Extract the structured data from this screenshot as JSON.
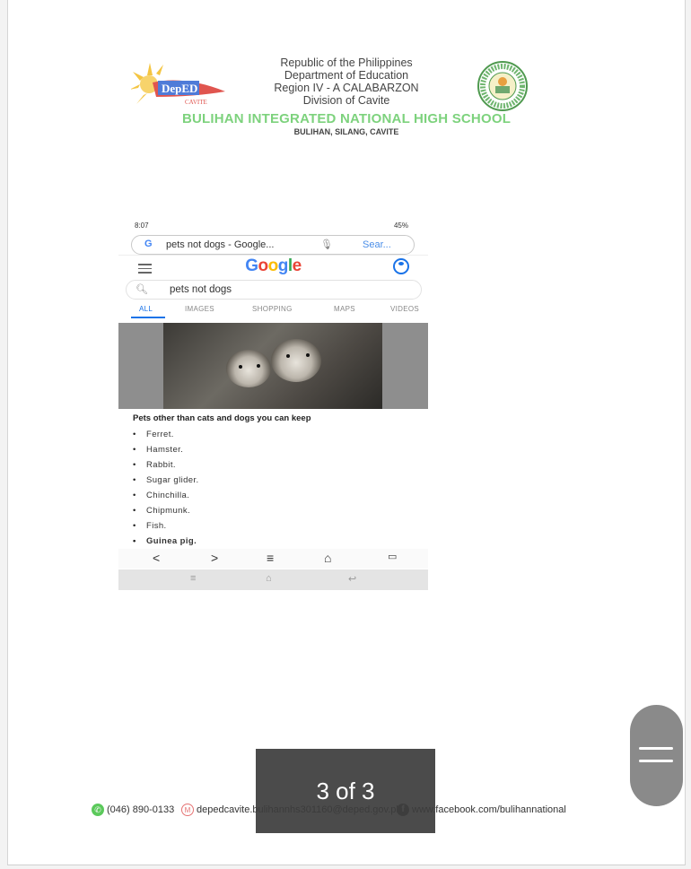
{
  "header": {
    "line1": "Republic of the Philippines",
    "line2": "Department of Education",
    "line3": "Region IV - A CALABARZON",
    "line4": "Division of Cavite",
    "school": "BULIHAN INTEGRATED NATIONAL HIGH SCHOOL",
    "address": "BULIHAN, SILANG, CAVITE",
    "logo_text": "DepED",
    "logo_sub": "CAVITE"
  },
  "phone": {
    "time": "8:07",
    "status_right": "45%",
    "url_text": "pets not dogs - Google...",
    "url_action": "Sear...",
    "google_logo": [
      "G",
      "o",
      "o",
      "g",
      "l",
      "e"
    ],
    "google_colors": [
      "#4285f4",
      "#ea4335",
      "#fbbc05",
      "#4285f4",
      "#34a853",
      "#ea4335"
    ],
    "search_query": "pets not dogs",
    "tabs": [
      "ALL",
      "IMAGES",
      "SHOPPING",
      "MAPS",
      "VIDEOS"
    ],
    "result_title": "Pets other than cats and dogs you can keep",
    "pets": [
      "Ferret.",
      "Hamster.",
      "Rabbit.",
      "Sugar glider.",
      "Chinchilla.",
      "Chipmunk.",
      "Fish.",
      "Guinea pig."
    ]
  },
  "footer": {
    "phone": "(046) 890-0133",
    "email": "depedcavite.bulihannhs301160@deped.gov.ph",
    "facebook": "www.facebook.com/bulihannational"
  },
  "viewer": {
    "page_indicator": "3 of 3"
  }
}
